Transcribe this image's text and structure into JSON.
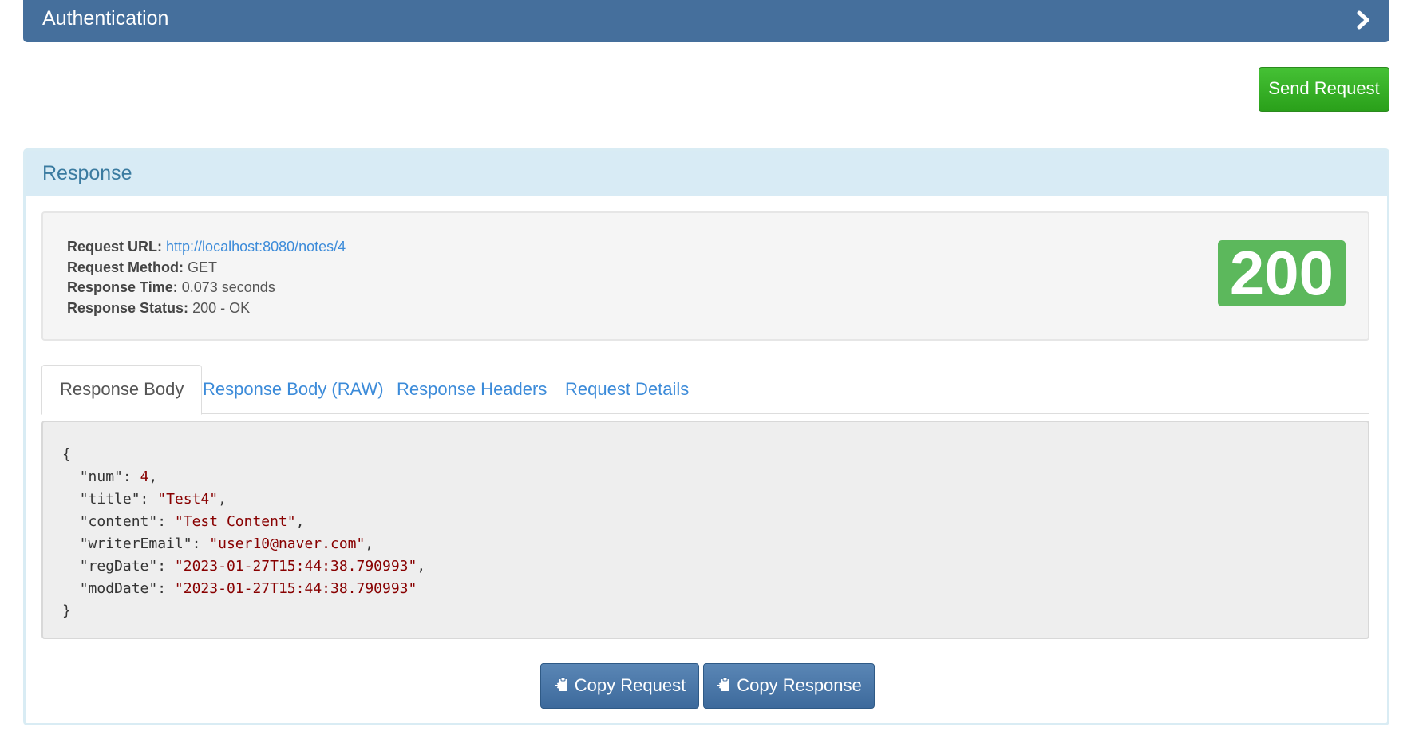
{
  "auth": {
    "title": "Authentication",
    "chevron_icon": "chevron-right-icon"
  },
  "send_button": {
    "label": "Send Request"
  },
  "response": {
    "title": "Response",
    "info": {
      "url_label": "Request URL:",
      "url_value": "http://localhost:8080/notes/4",
      "method_label": "Request Method:",
      "method_value": "GET",
      "time_label": "Response Time:",
      "time_value": "0.073 seconds",
      "status_label": "Response Status:",
      "status_value": "200 - OK"
    },
    "status_badge": "200",
    "status_color": "#5cb85c",
    "tabs": [
      {
        "label": "Response Body",
        "active": true
      },
      {
        "label": "Response Body (RAW)",
        "active": false
      },
      {
        "label": "Response Headers",
        "active": false
      },
      {
        "label": "Request Details",
        "active": false
      }
    ],
    "body": {
      "open_brace": "{",
      "close_brace": "}",
      "fields": [
        {
          "key": "\"num\"",
          "value": "4",
          "suffix": ","
        },
        {
          "key": "\"title\"",
          "value": "\"Test4\"",
          "suffix": ","
        },
        {
          "key": "\"content\"",
          "value": "\"Test Content\"",
          "suffix": ","
        },
        {
          "key": "\"writerEmail\"",
          "value": "\"user10@naver.com\"",
          "suffix": ","
        },
        {
          "key": "\"regDate\"",
          "value": "\"2023-01-27T15:44:38.790993\"",
          "suffix": ","
        },
        {
          "key": "\"modDate\"",
          "value": "\"2023-01-27T15:44:38.790993\"",
          "suffix": ""
        }
      ]
    },
    "copy_request_label": "Copy Request",
    "copy_response_label": "Copy Response",
    "copy_icon": "clipboard-icon"
  },
  "colors": {
    "header_blue": "#456f9c",
    "send_green": "#2aa01a",
    "link_blue": "#3c8bd9",
    "json_string": "#880000"
  }
}
